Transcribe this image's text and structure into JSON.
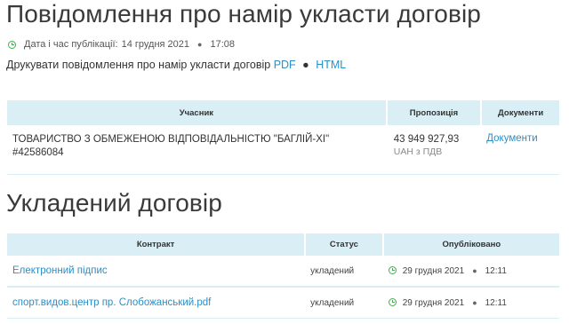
{
  "notice": {
    "title": "Повідомлення про намір укласти договір",
    "pub_label": "Дата і час публікації:",
    "pub_date": "14 грудня 2021",
    "pub_time": "17:08",
    "print_text": "Друкувати повідомлення про намір укласти договір",
    "pdf_label": "PDF",
    "separator": "●",
    "html_label": "HTML"
  },
  "participants_table": {
    "headers": [
      "Учасник",
      "Пропозиція",
      "Документи"
    ],
    "rows": [
      {
        "company": "ТОВАРИСТВО З ОБМЕЖЕНОЮ ВІДПОВІДАЛЬНІСТЮ \"БАГЛІЙ-ХІ\"",
        "code": "#42586084",
        "amount": "43 949 927,93",
        "vat": "UAH з ПДВ",
        "docs_label": "Документи"
      }
    ]
  },
  "contract": {
    "title": "Укладений договір",
    "headers": [
      "Контракт",
      "Статус",
      "Опубліковано"
    ],
    "rows": [
      {
        "name": "Електронний підпис",
        "status": "укладений",
        "date": "29 грудня 2021",
        "time": "12:11"
      },
      {
        "name": "спорт.видов.центр пр. Слобожанський.pdf",
        "status": "укладений",
        "date": "29 грудня 2021",
        "time": "12:11"
      }
    ]
  },
  "colors": {
    "link": "#2a8fc7",
    "header_bg": "#d9eef5",
    "clock_icon": "#3bb24a"
  }
}
